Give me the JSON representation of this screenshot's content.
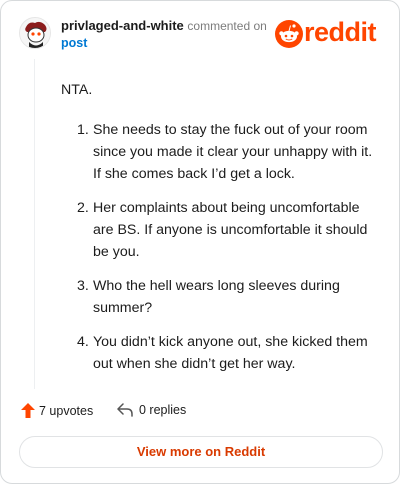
{
  "header": {
    "username": "privlaged-and-white",
    "commented_text": "commented on",
    "post_link": "post",
    "logo_text": "reddit"
  },
  "comment": {
    "intro": "NTA.",
    "items": [
      {
        "num": "1.",
        "text": "She needs to stay the fuck out of your room since you made it clear your unhappy with it. If she comes back I’d get a lock."
      },
      {
        "num": "2.",
        "text": "Her complaints about being uncomfortable are BS. If anyone is uncomfortable it should be you."
      },
      {
        "num": "3.",
        "text": "Who the hell wears long sleeves during summer?"
      },
      {
        "num": "4.",
        "text": "You didn’t kick anyone out, she kicked them out when she didn’t get her way."
      }
    ]
  },
  "footer": {
    "upvotes": "7 upvotes",
    "replies": "0 replies",
    "view_more": "View more on Reddit"
  },
  "colors": {
    "brand": "#ff4500",
    "link": "#0079d3",
    "button_text": "#d93a00"
  }
}
